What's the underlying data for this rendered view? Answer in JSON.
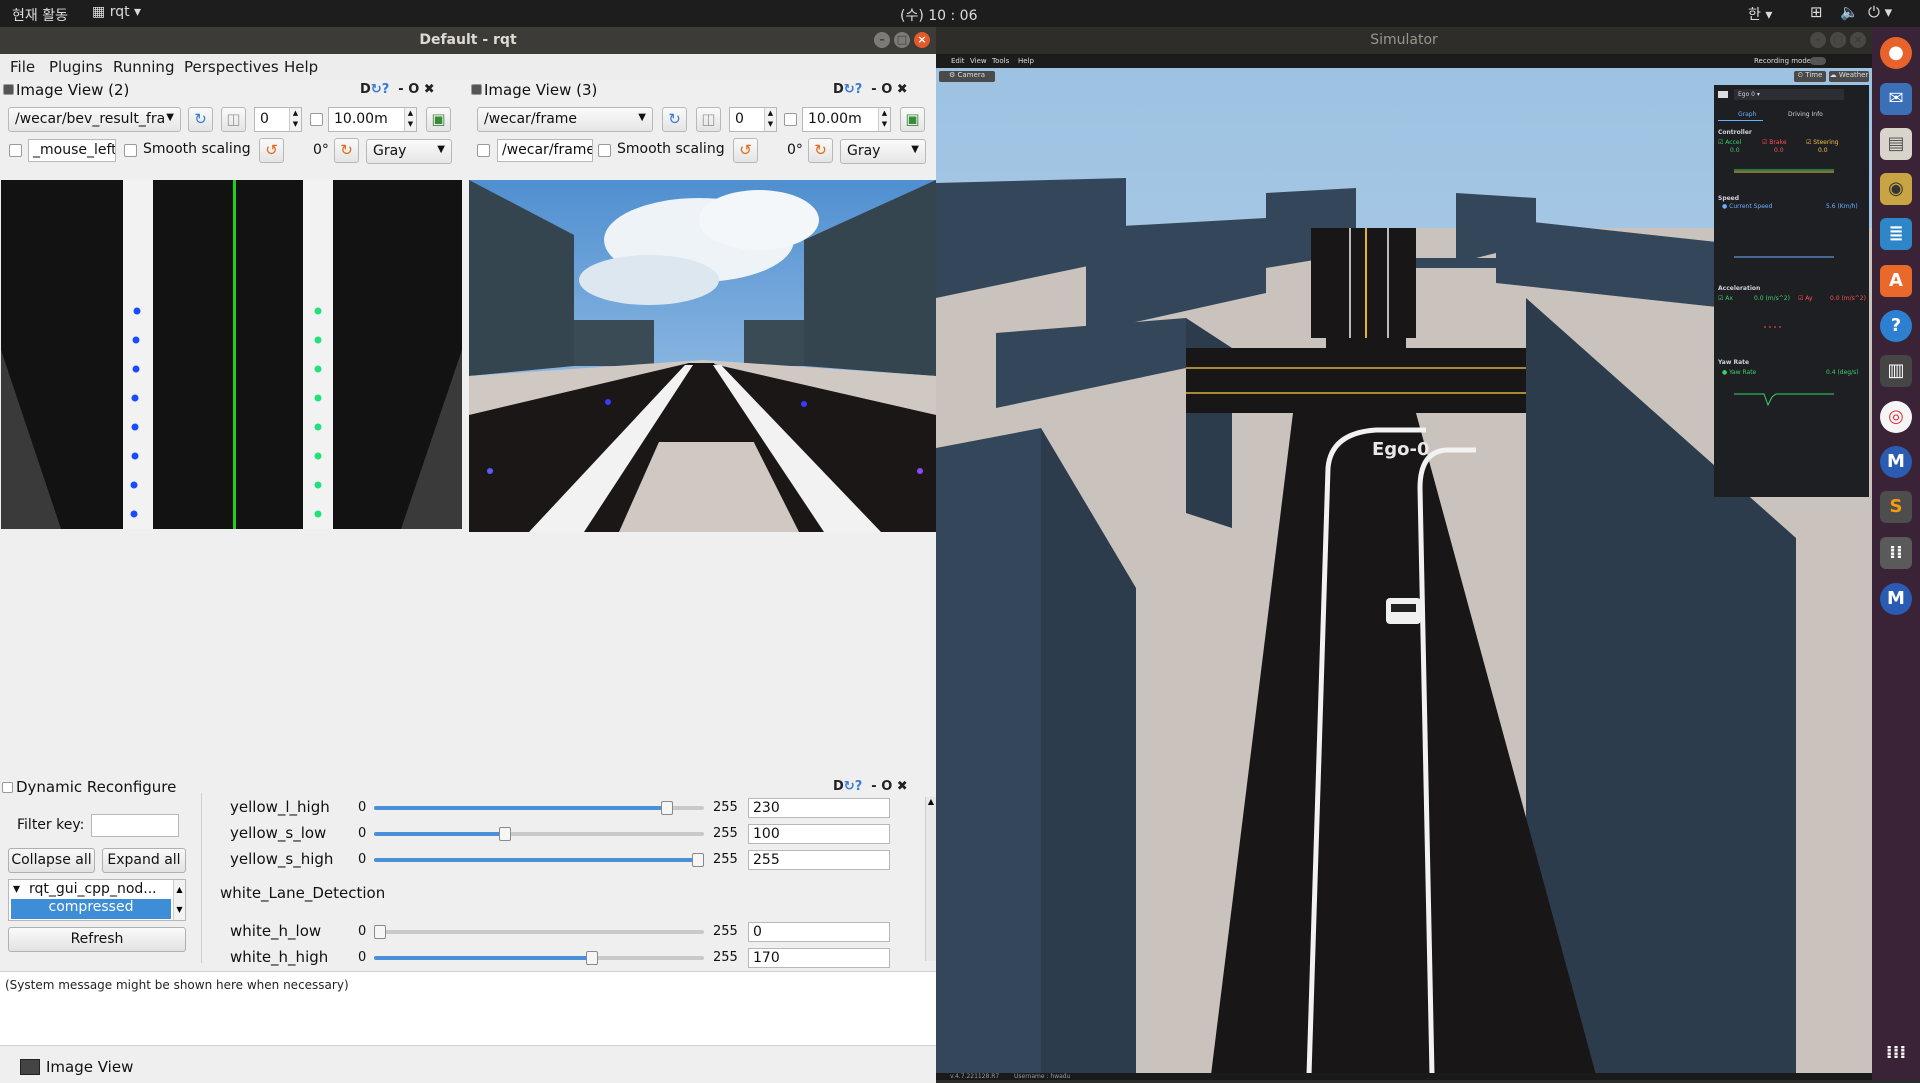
{
  "topbar": {
    "activities": "현재 활동",
    "app": "rqt",
    "clock": "(수) 10 : 06",
    "lang": "한"
  },
  "rqt": {
    "title": "Default - rqt",
    "menu": [
      "File",
      "Plugins",
      "Running",
      "Perspectives",
      "Help"
    ],
    "view2": {
      "title": "Image View (2)",
      "topic": "/wecar/bev_result_fra",
      "spin_value": "0",
      "range_value": "10.00m",
      "mouse_topic": "_mouse_left",
      "smooth_label": "Smooth scaling",
      "rotation": "0°",
      "colormap": "Gray"
    },
    "view3": {
      "title": "Image View (3)",
      "topic": "/wecar/frame",
      "spin_value": "0",
      "range_value": "10.00m",
      "mouse_topic": "/wecar/frame",
      "smooth_label": "Smooth scaling",
      "rotation": "0°",
      "colormap": "Gray"
    },
    "dock_controls": "D",
    "dynreconf": {
      "title": "Dynamic Reconfigure",
      "filter_label": "Filter key:",
      "collapse_label": "Collapse all",
      "expand_label": "Expand all",
      "tree_item": "rqt_gui_cpp_nod...",
      "tree_selected": "compressed",
      "refresh_label": "Refresh",
      "group_label": "white_Lane_Detection",
      "params": [
        {
          "name": "yellow_l_high",
          "min": "0",
          "max": "255",
          "value": "230",
          "frac": 0.902
        },
        {
          "name": "yellow_s_low",
          "min": "0",
          "max": "255",
          "value": "100",
          "frac": 0.392
        },
        {
          "name": "yellow_s_high",
          "min": "0",
          "max": "255",
          "value": "255",
          "frac": 1.0
        },
        {
          "name": "white_h_low",
          "min": "0",
          "max": "255",
          "value": "0",
          "frac": 0.0
        },
        {
          "name": "white_h_high",
          "min": "0",
          "max": "255",
          "value": "170",
          "frac": 0.667
        }
      ]
    },
    "console_text": "(System message might be shown here when necessary)",
    "bottom_tab": "Image View"
  },
  "simulator": {
    "title": "Simulator",
    "menu": [
      "Edit",
      "View",
      "Tools",
      "Help"
    ],
    "recording_label": "Recording mode",
    "camera_btn": "Camera",
    "time_btn": "Time",
    "weather_btn": "Weather",
    "vehicle_label": "Ego-0",
    "panel": {
      "ego_select": "Ego 0",
      "tab_graph": "Graph",
      "tab_driving": "Driving Info",
      "controller_label": "Controller",
      "accel_label": "Accel",
      "brake_label": "Brake",
      "steering_label": "Steering",
      "accel_value": "0.0",
      "brake_value": "0.0",
      "steering_value": "0.0",
      "speed_label": "Speed",
      "current_speed_label": "Current Speed",
      "speed_value": "5.6 (Km/h)",
      "accel_section": "Acceleration",
      "ax_label": "Ax",
      "ax_value": "0.0 (m/s^2)",
      "ay_label": "Ay",
      "ay_value": "0.0 (m/s^2)",
      "yaw_section": "Yaw Rate",
      "yaw_label": "Yaw Rate",
      "yaw_value": "0.4 (deg/s)"
    },
    "status_version": "v.4.7.221128.R7",
    "status_user": "Username : hwadu"
  }
}
